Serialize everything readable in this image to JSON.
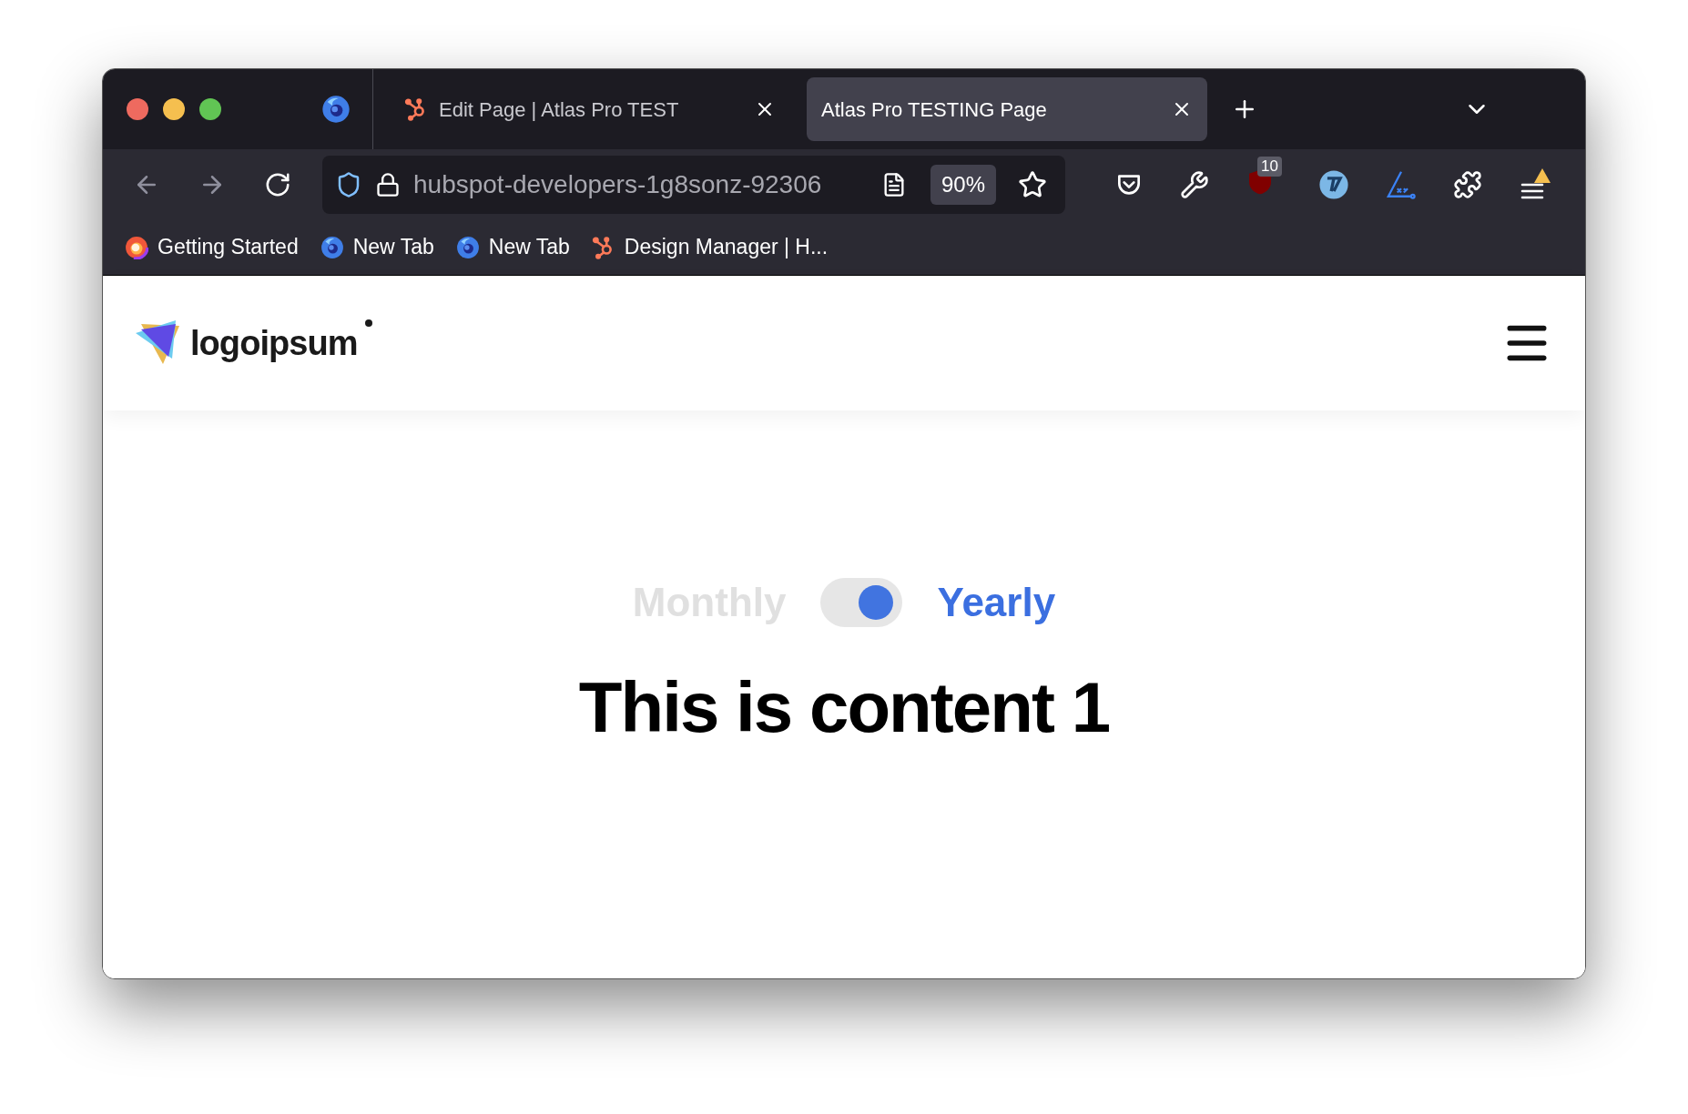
{
  "tabs": [
    {
      "title": "Edit Page | Atlas Pro TEST",
      "kind": "hubspot",
      "selected": false
    },
    {
      "title": "Atlas Pro TESTING Page",
      "selected": true
    }
  ],
  "address_bar": {
    "url": "hubspot-developers-1g8sonz-92306",
    "zoom": "90%"
  },
  "extensions": {
    "ublock_badge": "10"
  },
  "bookmarks": [
    {
      "label": "Getting Started",
      "kind": "nightly"
    },
    {
      "label": "New Tab",
      "kind": "firefox"
    },
    {
      "label": "New Tab",
      "kind": "firefox"
    },
    {
      "label": "Design Manager | H...",
      "kind": "hubspot"
    }
  ],
  "site_header": {
    "logo_text": "logoipsum"
  },
  "billing_toggle": {
    "options": [
      {
        "label": "Monthly",
        "selected": false
      },
      {
        "label": "Yearly",
        "selected": true
      }
    ]
  },
  "content": {
    "heading": "This is content 1"
  }
}
